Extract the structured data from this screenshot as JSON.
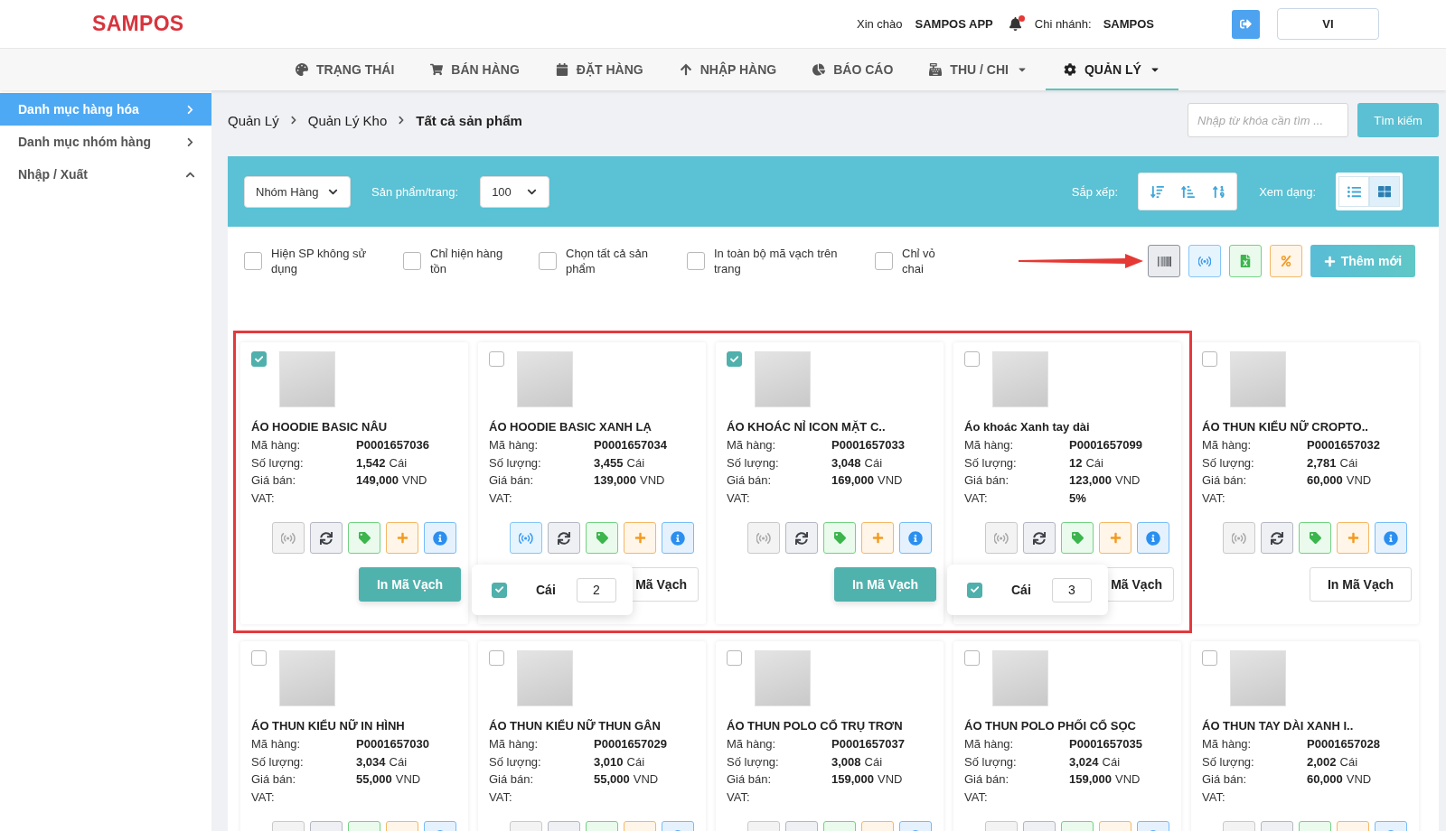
{
  "header": {
    "logo": "SAMPOS",
    "greeting": "Xin chào",
    "user": "SAMPOS APP",
    "notifications": true,
    "branch_label": "Chi nhánh:",
    "branch": "SAMPOS",
    "language": "VI"
  },
  "nav": [
    {
      "label": "TRẠNG THÁI",
      "selected": false,
      "dropdown": false
    },
    {
      "label": "BÁN HÀNG",
      "selected": false,
      "dropdown": false
    },
    {
      "label": "ĐẶT HÀNG",
      "selected": false,
      "dropdown": false
    },
    {
      "label": "NHẬP HÀNG",
      "selected": false,
      "dropdown": false
    },
    {
      "label": "BÁO CÁO",
      "selected": false,
      "dropdown": false
    },
    {
      "label": "THU / CHI",
      "selected": false,
      "dropdown": true
    },
    {
      "label": "QUẢN LÝ",
      "selected": true,
      "dropdown": true
    }
  ],
  "sidebar": [
    {
      "label": "Danh mục hàng hóa",
      "selected": true,
      "expanded": false
    },
    {
      "label": "Danh mục nhóm hàng",
      "selected": false,
      "expanded": false
    },
    {
      "label": "Nhập / Xuất",
      "selected": false,
      "expanded": true
    }
  ],
  "breadcrumb": [
    "Quản Lý",
    "Quản Lý Kho",
    "Tất cả sản phẩm"
  ],
  "search": {
    "placeholder": "Nhập từ khóa cần tìm ...",
    "button": "Tìm kiếm"
  },
  "toolbar": {
    "group_select": "Nhóm Hàng",
    "per_page_label": "Sản phẩm/trang:",
    "per_page": "100",
    "sort_label": "Sắp xếp:",
    "view_label": "Xem dạng:",
    "views": [
      {
        "kind": "list",
        "selected": false
      },
      {
        "kind": "grid",
        "selected": true
      }
    ]
  },
  "filters": [
    {
      "label": "Hiện SP không sử dụng",
      "checked": false
    },
    {
      "label": "Chỉ hiện hàng tồn",
      "checked": false
    },
    {
      "label": "Chọn tất cả sản phẩm",
      "checked": false
    },
    {
      "label": "In toàn bộ mã vạch trên trang",
      "checked": false
    },
    {
      "label": "Chỉ vỏ chai",
      "checked": false
    }
  ],
  "add_button": "Thêm mới",
  "products": [
    {
      "name": "ÁO HOODIE BASIC NÂU",
      "checked": true,
      "rfid": false,
      "fields": [
        {
          "label": "Mã hàng:",
          "value": "P0001657036"
        },
        {
          "label": "Số lượng:",
          "value": "1,542",
          "unit": "Cái"
        },
        {
          "label": "Giá bán:",
          "value": "149,000",
          "unit": "VND"
        },
        {
          "label": "VAT:"
        }
      ],
      "print": {
        "label": "In Mã Vạch",
        "primary": true
      }
    },
    {
      "name": "ÁO HOODIE BASIC XANH LẠ",
      "checked": false,
      "rfid": true,
      "fields": [
        {
          "label": "Mã hàng:",
          "value": "P0001657034"
        },
        {
          "label": "Số lượng:",
          "value": "3,455",
          "unit": "Cái"
        },
        {
          "label": "Giá bán:",
          "value": "139,000",
          "unit": "VND"
        },
        {
          "label": "VAT:"
        }
      ],
      "print": {
        "label": "Mã Vạch",
        "primary": false
      },
      "popup": {
        "checked": true,
        "unit": "Cái",
        "quantity": "2"
      }
    },
    {
      "name": "ÁO KHOÁC NỈ ICON MẶT C..",
      "checked": true,
      "rfid": false,
      "fields": [
        {
          "label": "Mã hàng:",
          "value": "P0001657033"
        },
        {
          "label": "Số lượng:",
          "value": "3,048",
          "unit": "Cái"
        },
        {
          "label": "Giá bán:",
          "value": "169,000",
          "unit": "VND"
        },
        {
          "label": "VAT:"
        }
      ],
      "print": {
        "label": "In Mã Vạch",
        "primary": true
      }
    },
    {
      "name": "Áo khoác Xanh tay dài",
      "checked": false,
      "rfid": false,
      "fields": [
        {
          "label": "Mã hàng:",
          "value": "P0001657099"
        },
        {
          "label": "Số lượng:",
          "value": "12",
          "unit": "Cái"
        },
        {
          "label": "Giá bán:",
          "value": "123,000",
          "unit": "VND"
        },
        {
          "label": "VAT:",
          "value": "5%"
        }
      ],
      "print": {
        "label": "Mã Vạch",
        "primary": false
      },
      "popup": {
        "checked": true,
        "unit": "Cái",
        "quantity": "3"
      }
    },
    {
      "name": "ÁO THUN KIỂU NỮ CROPTO..",
      "checked": false,
      "rfid": false,
      "fields": [
        {
          "label": "Mã hàng:",
          "value": "P0001657032"
        },
        {
          "label": "Số lượng:",
          "value": "2,781",
          "unit": "Cái"
        },
        {
          "label": "Giá bán:",
          "value": "60,000",
          "unit": "VND"
        },
        {
          "label": "VAT:"
        }
      ],
      "print": {
        "label": "In Mã Vạch",
        "primary": false
      }
    },
    {
      "name": "ÁO THUN KIỂU NỮ IN HÌNH",
      "checked": false,
      "rfid": false,
      "fields": [
        {
          "label": "Mã hàng:",
          "value": "P0001657030"
        },
        {
          "label": "Số lượng:",
          "value": "3,034",
          "unit": "Cái"
        },
        {
          "label": "Giá bán:",
          "value": "55,000",
          "unit": "VND"
        },
        {
          "label": "VAT:"
        }
      ]
    },
    {
      "name": "ÁO THUN KIỂU NỮ THUN GÂN",
      "checked": false,
      "rfid": false,
      "fields": [
        {
          "label": "Mã hàng:",
          "value": "P0001657029"
        },
        {
          "label": "Số lượng:",
          "value": "3,010",
          "unit": "Cái"
        },
        {
          "label": "Giá bán:",
          "value": "55,000",
          "unit": "VND"
        },
        {
          "label": "VAT:"
        }
      ]
    },
    {
      "name": "ÁO THUN POLO CỔ TRỤ TRƠN",
      "checked": false,
      "rfid": false,
      "fields": [
        {
          "label": "Mã hàng:",
          "value": "P0001657037"
        },
        {
          "label": "Số lượng:",
          "value": "3,008",
          "unit": "Cái"
        },
        {
          "label": "Giá bán:",
          "value": "159,000",
          "unit": "VND"
        },
        {
          "label": "VAT:"
        }
      ]
    },
    {
      "name": "ÁO THUN POLO PHỐI CỔ SỌC",
      "checked": false,
      "rfid": false,
      "fields": [
        {
          "label": "Mã hàng:",
          "value": "P0001657035"
        },
        {
          "label": "Số lượng:",
          "value": "3,024",
          "unit": "Cái"
        },
        {
          "label": "Giá bán:",
          "value": "159,000",
          "unit": "VND"
        },
        {
          "label": "VAT:"
        }
      ]
    },
    {
      "name": "ÁO THUN TAY DÀI XANH I..",
      "checked": false,
      "rfid": false,
      "fields": [
        {
          "label": "Mã hàng:",
          "value": "P0001657028"
        },
        {
          "label": "Số lượng:",
          "value": "2,002",
          "unit": "Cái"
        },
        {
          "label": "Giá bán:",
          "value": "60,000",
          "unit": "VND"
        },
        {
          "label": "VAT:"
        }
      ]
    }
  ]
}
